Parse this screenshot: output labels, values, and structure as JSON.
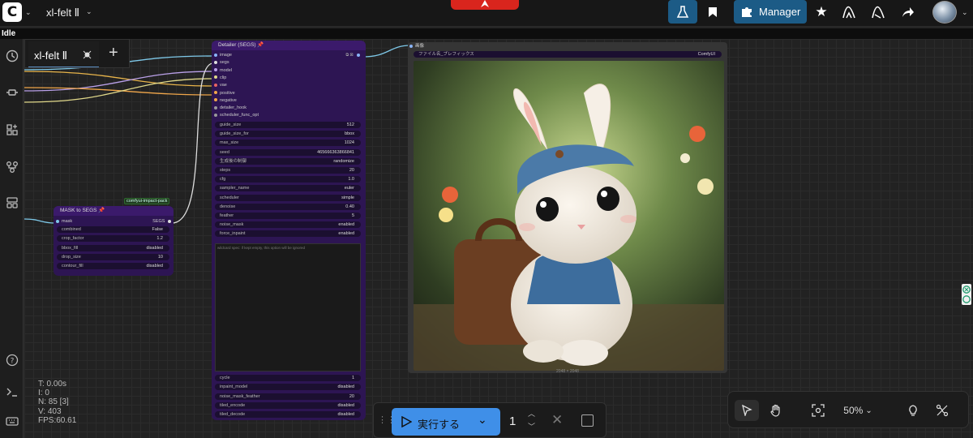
{
  "topbar": {
    "app_logo": "C",
    "workflow_title": "xl-felt Ⅱ",
    "manager_label": "Manager",
    "icons": [
      "logo-chevron",
      "title-chevron",
      "queue-icon",
      "bookmark-icon",
      "puzzle-icon",
      "star-icon",
      "wave-icon",
      "wave2-icon",
      "share-icon",
      "avatar-chevron"
    ]
  },
  "status": {
    "text": "Idle"
  },
  "tabs": {
    "active": "xl-felt Ⅱ",
    "add": "+"
  },
  "detailer": {
    "title": "Detailer (SEGS)",
    "inputs": [
      "image",
      "segs",
      "model",
      "clip",
      "vae",
      "positive",
      "negative",
      "detailer_hook",
      "scheduler_func_opt"
    ],
    "output": "image",
    "widgets": [
      {
        "label": "guide_size",
        "value": "512"
      },
      {
        "label": "guide_size_for",
        "value": "bbox"
      },
      {
        "label": "max_size",
        "value": "1024"
      },
      {
        "label": "seed",
        "value": "465666363866841"
      },
      {
        "label": "生成後の制御",
        "value": "randomize"
      },
      {
        "label": "steps",
        "value": "20"
      },
      {
        "label": "cfg",
        "value": "1.0"
      },
      {
        "label": "sampler_name",
        "value": "euler"
      },
      {
        "label": "scheduler",
        "value": "simple"
      },
      {
        "label": "denoise",
        "value": "0.40"
      },
      {
        "label": "feather",
        "value": "5"
      },
      {
        "label": "noise_mask",
        "value": "enabled"
      },
      {
        "label": "force_inpaint",
        "value": "enabled"
      }
    ],
    "textarea_placeholder": "wildcard spec: if kept empty, this option will be ignored",
    "widgets_bottom": [
      {
        "label": "cycle",
        "value": "1"
      },
      {
        "label": "inpaint_model",
        "value": "disabled"
      },
      {
        "label": "noise_mask_feather",
        "value": "20"
      },
      {
        "label": "tiled_encode",
        "value": "disabled"
      },
      {
        "label": "tiled_decode",
        "value": "disabled"
      }
    ]
  },
  "mask_node": {
    "badge": "comfyui-impact-pack",
    "title": "MASK to SEGS",
    "input": "mask",
    "output": "SEGS",
    "widgets": [
      {
        "label": "combined",
        "value": "False"
      },
      {
        "label": "crop_factor",
        "value": "1.2"
      },
      {
        "label": "bbox_fill",
        "value": "disabled"
      },
      {
        "label": "drop_size",
        "value": "10"
      },
      {
        "label": "contour_fill",
        "value": "disabled"
      }
    ]
  },
  "image_panel": {
    "title": "画像",
    "prefix_label": "ファイル名_プレフィックス",
    "prefix_value": "ComfyUI",
    "dimensions": "2048 × 2048"
  },
  "stats": [
    "T: 0.00s",
    "I: 0",
    "N: 85 [3]",
    "V: 403",
    "FPS:60.61"
  ],
  "runbar": {
    "run_label": "実行する",
    "batch_count": "1"
  },
  "canvas_toolbar": {
    "zoom": "50%"
  },
  "colors": {
    "accent": "#3f8fe8",
    "manager": "#1c5b86",
    "node_bg": "#2d1553",
    "node_header": "#3b1a6b",
    "red_button": "#d9251d"
  }
}
